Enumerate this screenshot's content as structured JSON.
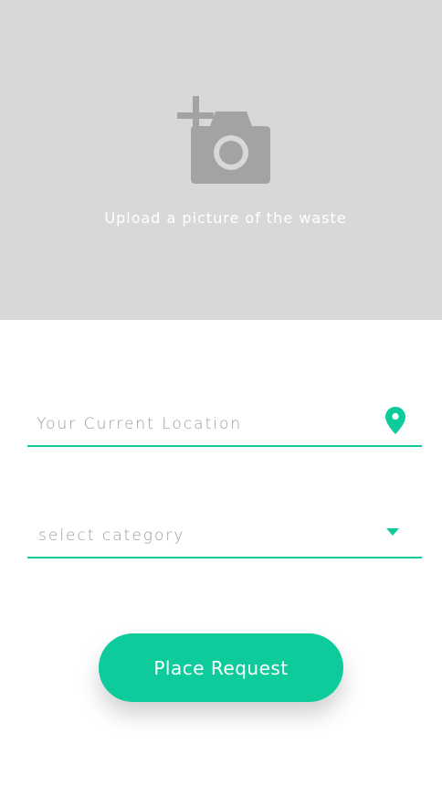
{
  "upload": {
    "label": "Upload a picture of the waste",
    "icon": "add-a-photo-icon"
  },
  "location_field": {
    "placeholder": "Your Current Location",
    "icon": "location-pin-icon"
  },
  "category_field": {
    "placeholder": "select category",
    "icon": "caret-down-icon"
  },
  "submit": {
    "label": "Place Request"
  },
  "colors": {
    "accent": "#0ecb9c",
    "upload_background": "#d8d8d8",
    "icon_gray": "#a3a3a3",
    "placeholder_text": "#9a9a9a"
  }
}
